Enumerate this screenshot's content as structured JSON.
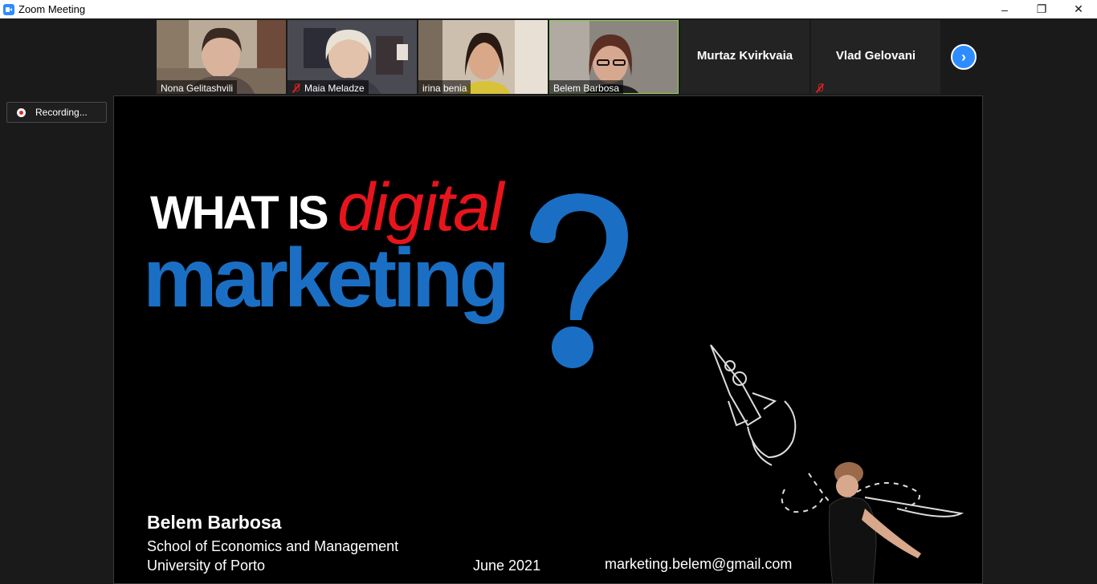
{
  "window": {
    "title": "Zoom Meeting",
    "minimize": "–",
    "restore": "❐",
    "close": "✕"
  },
  "gallery": {
    "participants": [
      {
        "name": "Nona Gelitashvili",
        "muted": false,
        "video": true
      },
      {
        "name": "Maia Meladze",
        "muted": true,
        "video": true
      },
      {
        "name": "irina benia",
        "muted": false,
        "video": true
      },
      {
        "name": "Belem Barbosa",
        "muted": false,
        "video": true,
        "active": true
      },
      {
        "name": "Murtaz Kvirkvaia",
        "muted": false,
        "video": false
      },
      {
        "name": "Vlad Gelovani",
        "muted": true,
        "video": false
      }
    ],
    "next_icon": "›"
  },
  "recording": {
    "label": "Recording..."
  },
  "slide": {
    "headline_part1": "WHAT IS",
    "headline_part2": "digital",
    "headline_part3": "marketing",
    "presenter": "Belem Barbosa",
    "school": "School of Economics and Management",
    "university": "University of Porto",
    "date": "June 2021",
    "email": "marketing.belem@gmail.com"
  },
  "colors": {
    "accent_blue": "#2d8cff",
    "slide_red": "#e8141c",
    "slide_blue": "#1a6fc4",
    "active_speaker": "#8fd14f",
    "muted": "#e02020"
  }
}
